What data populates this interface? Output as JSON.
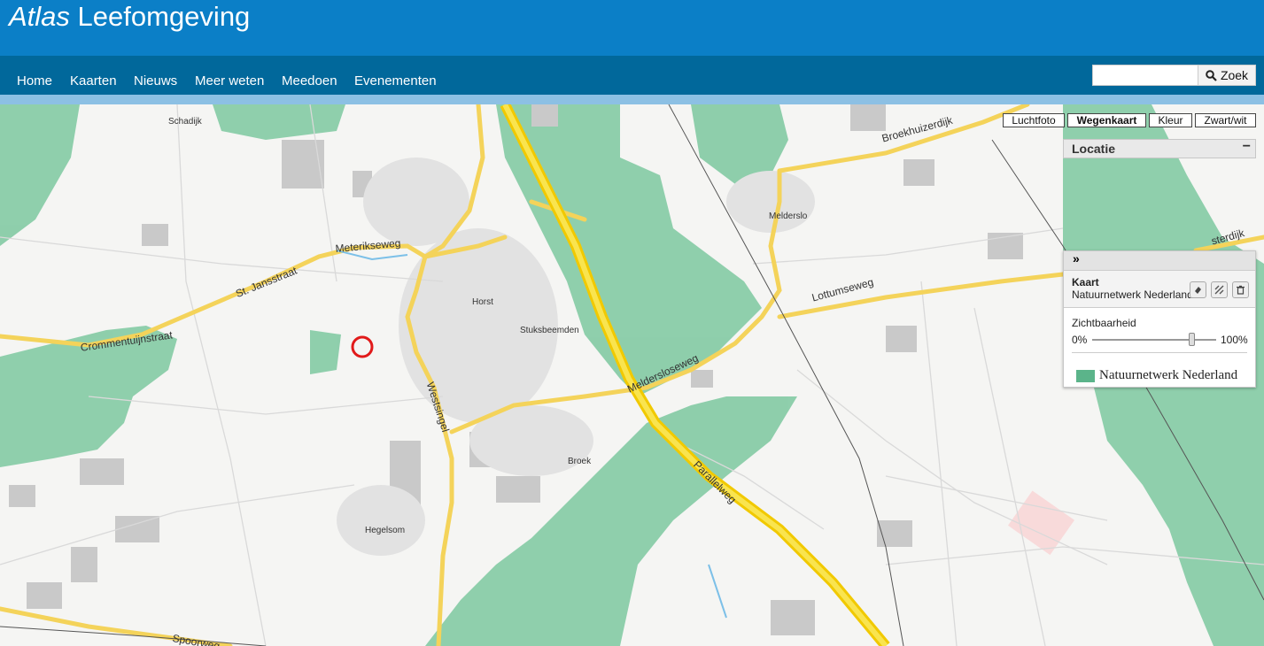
{
  "app": {
    "title_italic": "Atlas",
    "title_main": "Leefomgeving"
  },
  "nav": {
    "items": [
      "Home",
      "Kaarten",
      "Nieuws",
      "Meer weten",
      "Meedoen",
      "Evenementen"
    ]
  },
  "search": {
    "value": "",
    "button_label": "Zoek",
    "icon": "search-icon"
  },
  "map_type_buttons": [
    {
      "label": "Luchtfoto",
      "active": false
    },
    {
      "label": "Wegenkaart",
      "active": true
    },
    {
      "label": "Kleur",
      "active": false
    },
    {
      "label": "Zwart/wit",
      "active": false
    }
  ],
  "locatie_panel": {
    "title": "Locatie",
    "collapse_label": "−"
  },
  "layer_panel": {
    "toggle_label": "»",
    "layer_title": "Kaart",
    "layer_name": "Natuurnetwerk Nederland",
    "tools": [
      "eraser-icon",
      "compare-icon",
      "trash-icon"
    ],
    "opacity_label": "Zichtbaarheid",
    "opacity_min": "0%",
    "opacity_max": "100%",
    "opacity_value": 0.8,
    "legend_label": "Natuurnetwerk Nederland",
    "legend_color": "#5bb48a"
  },
  "map_labels": {
    "schadijk": "Schadijk",
    "broekhuizerdijk": "Broekhuizerdijk",
    "melderslo": "Melderslo",
    "meterikseweg": "Meterikseweg",
    "st_jansstraat": "St. Jansstraat",
    "crommentuijnstraat": "Crommentuijnstraat",
    "horst": "Horst",
    "stuksbeemden": "Stuksbeemden",
    "lottumseweg": "Lottumseweg",
    "meldersloseweg": "Meldersloseweg",
    "westsingel": "Westsingel",
    "broek": "Broek",
    "parallelweg": "Parallelweg",
    "hegelsom": "Hegelsom",
    "spoorweg": "Spoorweg",
    "sterdijk": "sterdijk"
  },
  "colors": {
    "header_blue": "#0b7fc7",
    "nav_blue": "#01689b",
    "nature_green": "#6cc194",
    "road_yellow": "#f4d35a",
    "highway": "#f1c900",
    "location_marker": "#e11a1a"
  }
}
